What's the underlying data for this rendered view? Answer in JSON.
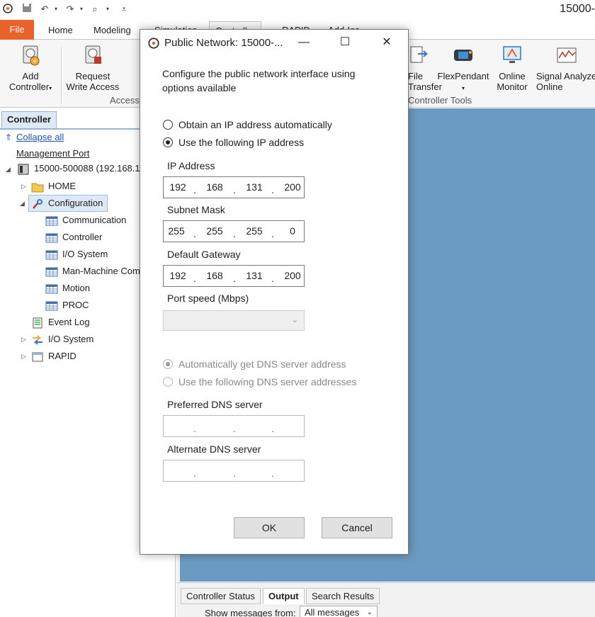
{
  "app": {
    "title": "15000-"
  },
  "qat": {
    "icons": [
      "app-logo-icon",
      "save-icon",
      "undo-icon",
      "redo-icon",
      "zoom-icon",
      "customize-icon"
    ]
  },
  "ribbon_tabs": [
    "File",
    "Home",
    "Modeling",
    "Simulation",
    "Controller",
    "RAPID",
    "Add-Ins"
  ],
  "ribbon": {
    "add_controller": "Add\nController",
    "request_write_access": "Request\nWrite Access",
    "access_group": "Access",
    "file_transfer": "File\nTransfer",
    "flexpendant": "FlexPendant",
    "online_monitor": "Online\nMonitor",
    "signal_analyzer": "Signal Analyzer\nOnline",
    "controller_tools_group": "Controller Tools"
  },
  "left_panel": {
    "tab": "Controller",
    "collapse_all": "Collapse all",
    "management_port": "Management Port",
    "controller_node": "15000-500088 (192.168.12",
    "tree": [
      {
        "label": "HOME"
      },
      {
        "label": "Configuration"
      },
      {
        "label": "Communication"
      },
      {
        "label": "Controller"
      },
      {
        "label": "I/O System"
      },
      {
        "label": "Man-Machine Com"
      },
      {
        "label": "Motion"
      },
      {
        "label": "PROC"
      },
      {
        "label": "Event Log"
      },
      {
        "label": "I/O System"
      },
      {
        "label": "RAPID"
      }
    ]
  },
  "bottom_panel": {
    "tabs": [
      "Controller Status",
      "Output",
      "Search Results"
    ],
    "show_from_label": "Show messages from:",
    "show_from_value": "All messages"
  },
  "dialog": {
    "title": "Public Network: 15000-...",
    "intro": "Configure the public network interface using options available",
    "radio_auto_ip": "Obtain an IP address automatically",
    "radio_manual_ip": "Use the following IP address",
    "ip_label": "IP Address",
    "ip": [
      "192",
      "168",
      "131",
      "200"
    ],
    "subnet_label": "Subnet Mask",
    "subnet": [
      "255",
      "255",
      "255",
      "0"
    ],
    "gateway_label": "Default Gateway",
    "gateway": [
      "192",
      "168",
      "131",
      "200"
    ],
    "port_speed_label": "Port speed (Mbps)",
    "port_speed_value": "",
    "radio_auto_dns": "Automatically get DNS server address",
    "radio_manual_dns": "Use the following DNS server addresses",
    "preferred_dns_label": "Preferred DNS server",
    "alternate_dns_label": "Alternate DNS server",
    "ok": "OK",
    "cancel": "Cancel"
  },
  "colors": {
    "file_tab": "#e8622a",
    "workspace": "#6b9bc0",
    "selection": "#dde9f5"
  }
}
